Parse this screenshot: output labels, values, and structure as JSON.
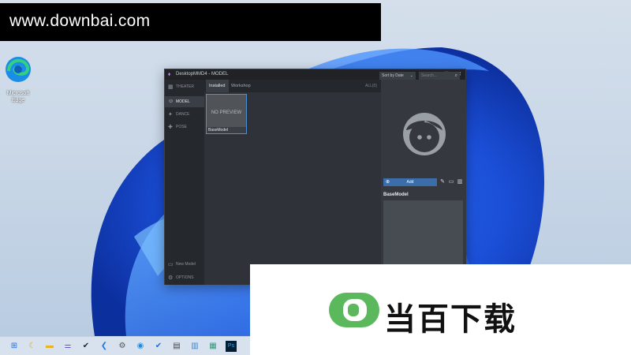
{
  "watermark_top": {
    "text": "www.downbai.com"
  },
  "watermark_bottom": {
    "logo_letter": "D",
    "text": "当百下载"
  },
  "desktop": {
    "icons": [
      {
        "label_line1": "Microsoft",
        "label_line2": "Edge",
        "icon": "edge-icon"
      }
    ]
  },
  "window": {
    "title": "DesktopMMD4 - MODEL",
    "controls": {
      "minimize": "—",
      "maximize": "☐",
      "close": "✕"
    },
    "sidebar": {
      "items": [
        {
          "label": "THEATER",
          "icon": "theater-icon",
          "active": false
        },
        {
          "label": "MODEL",
          "icon": "model-icon",
          "active": true
        },
        {
          "label": "DANCE",
          "icon": "dance-icon",
          "active": false
        },
        {
          "label": "POSE",
          "icon": "pose-icon",
          "active": false
        }
      ],
      "bottom": [
        {
          "label": "New Model",
          "icon": "new-model-icon"
        },
        {
          "label": "OPTIONS",
          "icon": "gear-icon"
        }
      ]
    },
    "tabs": [
      {
        "label": "Installed",
        "active": true
      },
      {
        "label": "Workshop",
        "active": false
      }
    ],
    "filter_label": "ALL(0)",
    "sort": {
      "value": "Sort by Date"
    },
    "search": {
      "placeholder": "Search..."
    },
    "models": [
      {
        "name": "BaseModel",
        "preview": "NO PREVIEW",
        "selected": true
      }
    ],
    "detail": {
      "add_label": "Add",
      "selected_name": "BaseModel"
    }
  },
  "taskbar": {
    "icons": [
      "windows-start-icon",
      "weather-icon",
      "file-explorer-icon",
      "tuning-fork-icon",
      "steam-icon",
      "vscode-icon",
      "settings-icon",
      "edge-icon",
      "checkmark-icon",
      "document-icon",
      "notepad-icon",
      "archive-icon",
      "photoshop-icon"
    ]
  },
  "colors": {
    "accent": "#3b6ea8",
    "selection": "#4a8fd8",
    "logo_green": "#5cb85c"
  }
}
